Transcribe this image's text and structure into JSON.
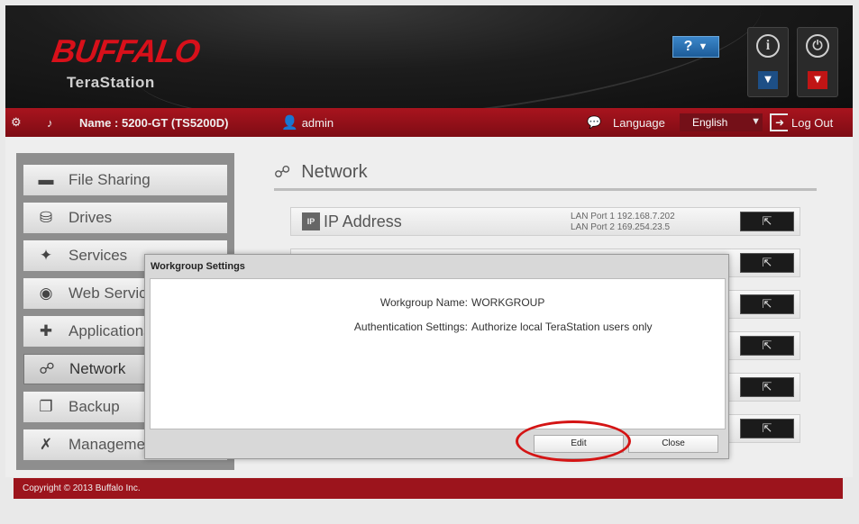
{
  "header": {
    "brand": "BUFFALO",
    "product": "TeraStation",
    "help_glyph": "?",
    "help_chevron": "▼",
    "info_glyph": "i",
    "power_glyph": "⏻",
    "dropdown_glyph": "▼"
  },
  "toolbar": {
    "gear_icon": "gear-icon",
    "music_icon": "music-note-icon",
    "device_name": "Name : 5200-GT (TS5200D)",
    "user_icon": "user-icon",
    "user": "admin",
    "language_label": "Language",
    "language_value": "English",
    "logout_label": "Log Out"
  },
  "sidebar": {
    "items": [
      {
        "label": "File Sharing",
        "icon": "folder-icon"
      },
      {
        "label": "Drives",
        "icon": "drive-icon"
      },
      {
        "label": "Services",
        "icon": "services-icon"
      },
      {
        "label": "Web Services",
        "icon": "web-services-icon"
      },
      {
        "label": "Applications",
        "icon": "applications-icon"
      },
      {
        "label": "Network",
        "icon": "network-icon",
        "active": true
      },
      {
        "label": "Backup",
        "icon": "backup-icon"
      },
      {
        "label": "Management",
        "icon": "wrench-icon"
      }
    ]
  },
  "content": {
    "title": "Network",
    "rows": [
      {
        "title": "IP Address",
        "icon_text": "IP",
        "detail_1": "LAN Port 1 192.168.7.202",
        "detail_2": "LAN Port 2 169.254.23.5"
      }
    ],
    "open_glyph": "⇱"
  },
  "dialog": {
    "title": "Workgroup Settings",
    "workgroup_label": "Workgroup Name:",
    "workgroup_value": "WORKGROUP",
    "auth_label": "Authentication Settings:",
    "auth_value": "Authorize local TeraStation users only",
    "edit_label": "Edit",
    "close_label": "Close"
  },
  "footer": {
    "copyright": "Copyright © 2013 Buffalo Inc."
  },
  "colors": {
    "brand_red": "#d8101a",
    "toolbar_red": "#9c141c",
    "help_blue": "#2a74b8",
    "annotation_red": "#d41414"
  }
}
